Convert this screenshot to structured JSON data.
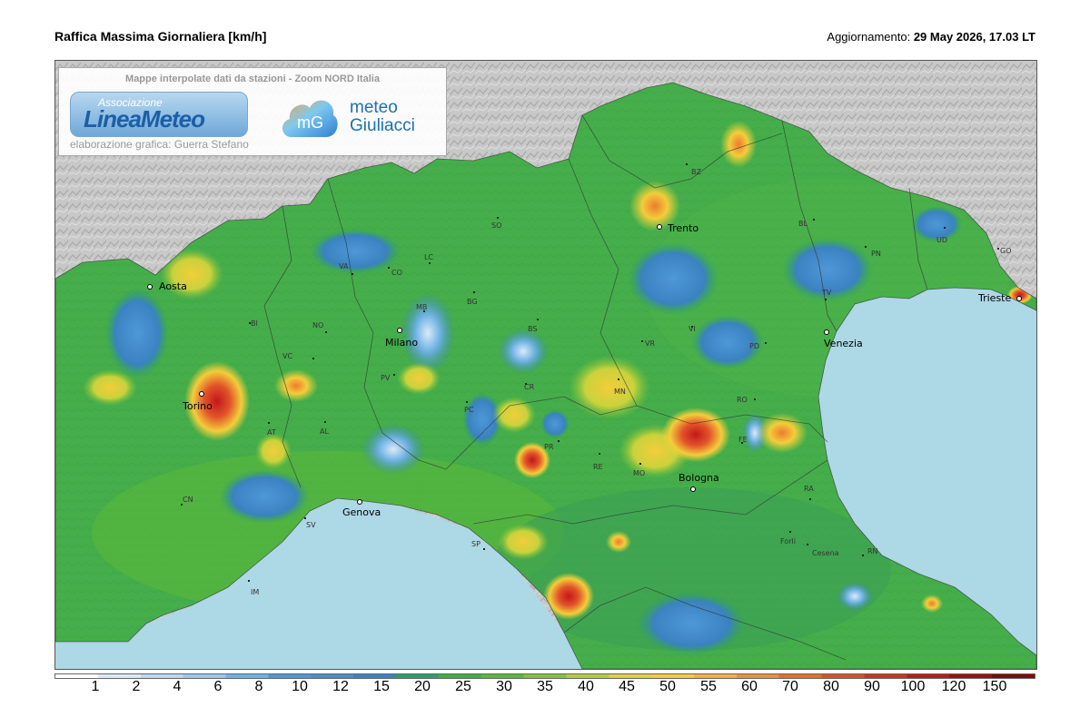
{
  "header": {
    "title": "Raffica Massima Giornaliera [km/h]",
    "update_label": "Aggiornamento:",
    "update_value": "29 May 2026, 17.03 LT"
  },
  "credits": {
    "title": "Mappe interpolate dati da stazioni - Zoom NORD Italia",
    "logo1_small": "Associazione",
    "logo1_main": "LineaMeteo",
    "author": "elaborazione grafica: Guerra Stefano",
    "logo2_line1": "meteo",
    "logo2_line2": "Giuliacci",
    "logo2_mark": "mG"
  },
  "map": {
    "cities": [
      "Aosta",
      "Torino",
      "Milano",
      "Genova",
      "Trento",
      "Venezia",
      "Bologna",
      "Trieste"
    ],
    "provinces": [
      "BZ",
      "SO",
      "BL",
      "UD",
      "GO",
      "PN",
      "VA",
      "CO",
      "LC",
      "BG",
      "TV",
      "MB",
      "BS",
      "BI",
      "NO",
      "VC",
      "VI",
      "VR",
      "PD",
      "PV",
      "CR",
      "MN",
      "RO",
      "PC",
      "AT",
      "AL",
      "PR",
      "FE",
      "RE",
      "MO",
      "CN",
      "RA",
      "SV",
      "SP",
      "Forli",
      "Cesena",
      "RN",
      "IM"
    ]
  },
  "legend": {
    "labels": [
      "1",
      "2",
      "4",
      "6",
      "8",
      "10",
      "12",
      "15",
      "20",
      "25",
      "30",
      "35",
      "40",
      "45",
      "50",
      "55",
      "60",
      "70",
      "80",
      "90",
      "100",
      "120",
      "150"
    ],
    "colors": [
      "#ffffff",
      "#dbeaf6",
      "#bcd9f0",
      "#9cc8ea",
      "#6fb2e4",
      "#4f98d8",
      "#4a8ec8",
      "#3a82c0",
      "#2e9e6a",
      "#3fae45",
      "#5ab83a",
      "#84c43a",
      "#b4cf3c",
      "#dcd43a",
      "#f3cd3a",
      "#f3b23a",
      "#f08f34",
      "#e86d2c",
      "#dc4f28",
      "#cc3320",
      "#b81c1a",
      "#9a1012",
      "#7a0a0c"
    ]
  }
}
